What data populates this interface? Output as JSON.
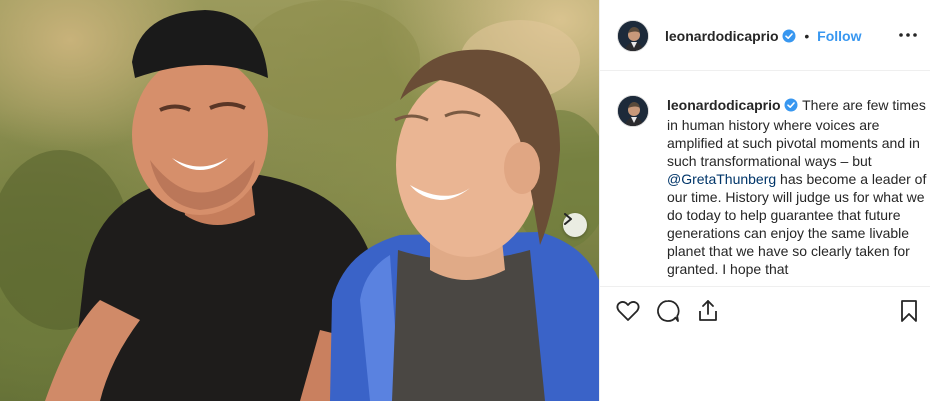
{
  "post": {
    "author": "leonardodicaprio",
    "follow_label": "Follow",
    "separator": "•",
    "caption_segments": [
      "There are few times in human history where voices are amplified at such pivotal moments and in such transformational ways – but ",
      "@GretaThunberg",
      " has become a leader of our time. History will judge us for what we do today to help guarantee that future generations can enjoy the same livable planet that we have so clearly taken for granted. I hope that"
    ]
  },
  "icons": {
    "verified": "verified-badge-icon",
    "more": "more-options-icon",
    "next": "carousel-next-icon",
    "like": "heart-icon",
    "comment": "comment-icon",
    "share": "share-icon",
    "save": "bookmark-icon"
  },
  "colors": {
    "link": "#3897f0",
    "mention": "#003569",
    "text": "#262626",
    "border": "#efefef"
  }
}
